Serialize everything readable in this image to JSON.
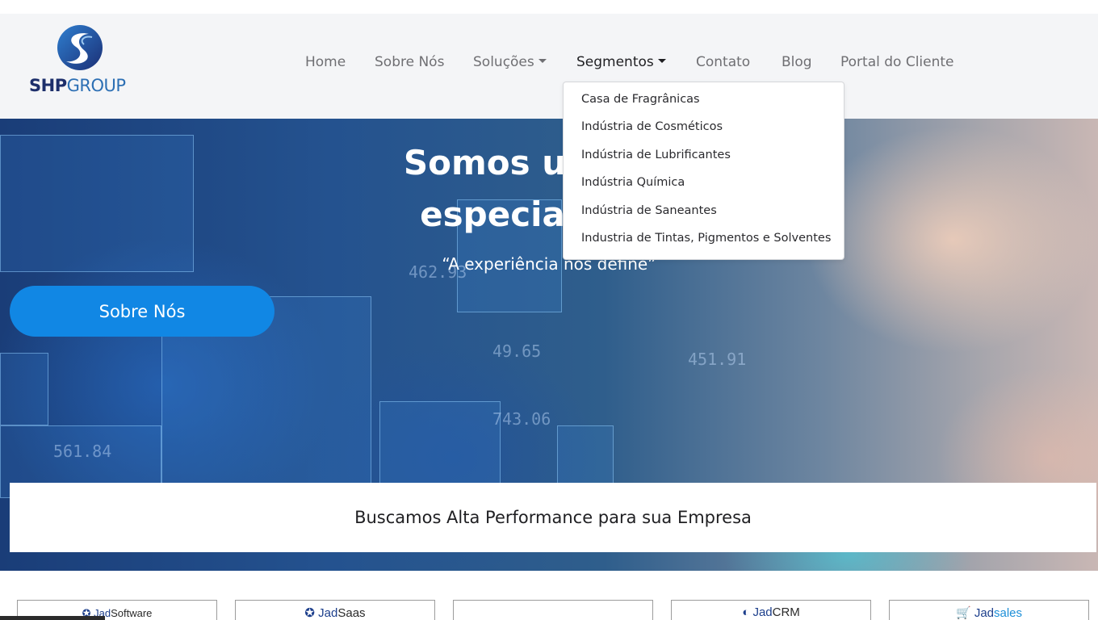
{
  "logo": {
    "brand_bold": "SHP",
    "brand_light": "GROUP",
    "icon": "shp-logo-mark"
  },
  "nav": {
    "home": "Home",
    "about": "Sobre Nós",
    "solutions": "Soluções",
    "segments": "Segmentos",
    "contact": "Contato",
    "blog": "Blog",
    "portal": "Portal do Cliente"
  },
  "dropdown": {
    "items": [
      "Casa de Fragrânicas",
      "Indústria de Cosméticos",
      "Indústria de Lubrificantes",
      "Indústria Química",
      "Indústria de Saneantes",
      "Industria de Tintas, Pigmentos e Solventes"
    ]
  },
  "hero": {
    "title_line1": "Somos uma em",
    "title_line2": "especializada",
    "quote": "“A experiência nos define”",
    "cta_label": "Sobre Nós",
    "background_numbers": [
      "462.93",
      "49.65",
      "451.91",
      "561.84",
      "743.06"
    ]
  },
  "banner": {
    "text": "Buscamos Alta Performance para sua Empresa"
  },
  "products": [
    {
      "brand": "Jad",
      "suffix": "Software"
    },
    {
      "brand": "Jad",
      "suffix": "Saas"
    },
    {
      "brand": "",
      "suffix": ""
    },
    {
      "brand": "Jad",
      "suffix": "CRM"
    },
    {
      "brand": "Jad",
      "suffix": "sales"
    }
  ],
  "colors": {
    "accent": "#1187e4",
    "nav_text": "#6f6f73",
    "nav_active": "#1f1f22",
    "brand_dark": "#1d2f6b",
    "brand_blue": "#2c6fb4"
  }
}
